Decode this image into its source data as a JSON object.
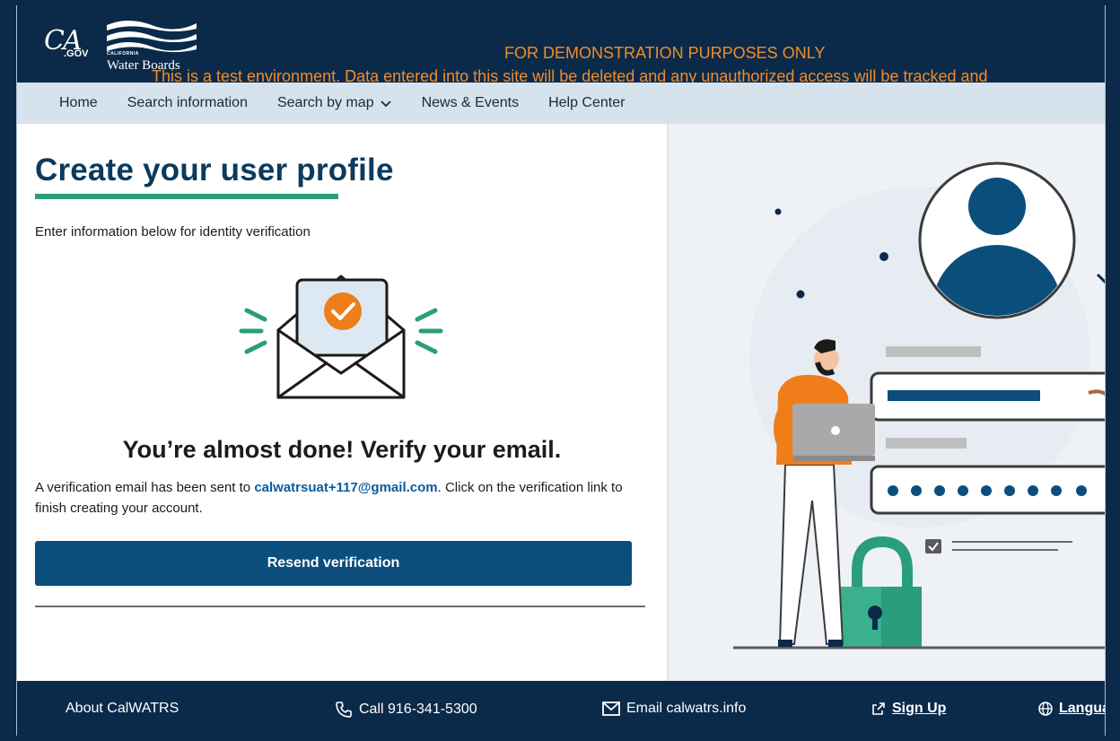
{
  "header": {
    "logo_ca": "CA",
    "logo_gov": ".GOV",
    "logo_state": "CALIFORNIA",
    "logo_agency": "Water Boards",
    "demo_title": "FOR DEMONSTRATION PURPOSES ONLY",
    "demo_warning": "This is a test environment. Data entered into this site will be deleted and any unauthorized access will be tracked and"
  },
  "nav": {
    "items": [
      {
        "label": "Home"
      },
      {
        "label": "Search information"
      },
      {
        "label": "Search by map"
      },
      {
        "label": "News & Events"
      },
      {
        "label": "Help Center"
      }
    ]
  },
  "main": {
    "title": "Create your user profile",
    "intro": "Enter information below for identity verification",
    "verify_heading": "You’re almost done! Verify your email.",
    "verify_body_prefix": "A verification email has been sent to ",
    "verify_email": "calwatrsuat+117@gmail.com",
    "verify_body_suffix": ". Click on the verification link to finish creating your account.",
    "resend_button": "Resend verification"
  },
  "footer": {
    "about": "About CalWATRS",
    "call": "Call 916-341-5300",
    "email": "Email calwatrs.info",
    "signup": "Sign Up",
    "language": "Langua"
  },
  "colors": {
    "brand_navy": "#0b2a4a",
    "accent_green": "#2a9d7c",
    "button_blue": "#0b4e7c",
    "warning_orange": "#f28c28",
    "nav_bg": "#d6e2ec"
  },
  "icons": [
    "ca-gov-logo",
    "water-boards-logo",
    "chevron-down-icon",
    "envelope-check-icon",
    "phone-icon",
    "mail-icon",
    "external-link-icon",
    "globe-icon"
  ]
}
